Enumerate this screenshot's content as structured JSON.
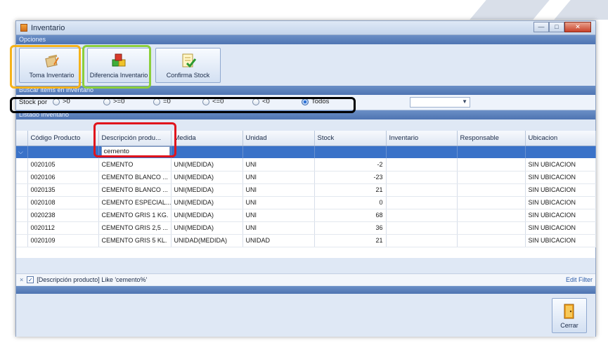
{
  "window": {
    "title": "Inventario"
  },
  "options_section": {
    "header": "Opciones",
    "buttons": [
      {
        "label": "Toma Inventario",
        "icon": "clipboard-pencil-icon"
      },
      {
        "label": "Diferencia Inventario",
        "icon": "cubes-icon"
      },
      {
        "label": "Confirma Stock",
        "icon": "checklist-icon"
      }
    ]
  },
  "search_section": {
    "header": "Buscar items en inventario",
    "stock_label": "Stock por",
    "radios": [
      {
        "label": ">0",
        "selected": false
      },
      {
        "label": ">=0",
        "selected": false
      },
      {
        "label": "=0",
        "selected": false
      },
      {
        "label": "<=0",
        "selected": false
      },
      {
        "label": "<0",
        "selected": false
      },
      {
        "label": "Todos",
        "selected": true
      }
    ],
    "combo_value": ""
  },
  "list_section": {
    "header": "Listado Inventario",
    "columns": [
      "Código Producto",
      "Descripción produ...",
      "Medida",
      "Unidad",
      "Stock",
      "Inventario",
      "Responsable",
      "Ubicacion"
    ],
    "filter_value": "cemento",
    "rows": [
      {
        "codigo": "0020105",
        "descripcion": "CEMENTO",
        "medida": "UNI(MEDIDA)",
        "unidad": "UNI",
        "stock": "-2",
        "inventario": "",
        "responsable": "",
        "ubicacion": "SIN UBICACION"
      },
      {
        "codigo": "0020106",
        "descripcion": "CEMENTO BLANCO ...",
        "medida": "UNI(MEDIDA)",
        "unidad": "UNI",
        "stock": "-23",
        "inventario": "",
        "responsable": "",
        "ubicacion": "SIN UBICACION"
      },
      {
        "codigo": "0020135",
        "descripcion": "CEMENTO BLANCO ...",
        "medida": "UNI(MEDIDA)",
        "unidad": "UNI",
        "stock": "21",
        "inventario": "",
        "responsable": "",
        "ubicacion": "SIN UBICACION"
      },
      {
        "codigo": "0020108",
        "descripcion": "CEMENTO ESPECIAL...",
        "medida": "UNI(MEDIDA)",
        "unidad": "UNI",
        "stock": "0",
        "inventario": "",
        "responsable": "",
        "ubicacion": "SIN UBICACION"
      },
      {
        "codigo": "0020238",
        "descripcion": "CEMENTO GRIS 1 KG.",
        "medida": "UNI(MEDIDA)",
        "unidad": "UNI",
        "stock": "68",
        "inventario": "",
        "responsable": "",
        "ubicacion": "SIN UBICACION"
      },
      {
        "codigo": "0020112",
        "descripcion": "CEMENTO GRIS 2,5 ...",
        "medida": "UNI(MEDIDA)",
        "unidad": "UNI",
        "stock": "36",
        "inventario": "",
        "responsable": "",
        "ubicacion": "SIN UBICACION"
      },
      {
        "codigo": "0020109",
        "descripcion": "CEMENTO GRIS 5 KL.",
        "medida": "UNIDAD(MEDIDA)",
        "unidad": "UNIDAD",
        "stock": "21",
        "inventario": "",
        "responsable": "",
        "ubicacion": "SIN UBICACION"
      }
    ]
  },
  "filter_panel": {
    "close_symbol": "×",
    "checked": true,
    "text": "[Descripción producto] Like 'cemento%'",
    "edit_label": "Edit Filter"
  },
  "footer": {
    "close_button_label": "Cerrar"
  },
  "highlight_colors": {
    "toma_inventario": "#f5b31b",
    "diferencia_inventario": "#8ccf3b",
    "stock_filter": "#000000",
    "column_filter": "#e0141c"
  }
}
